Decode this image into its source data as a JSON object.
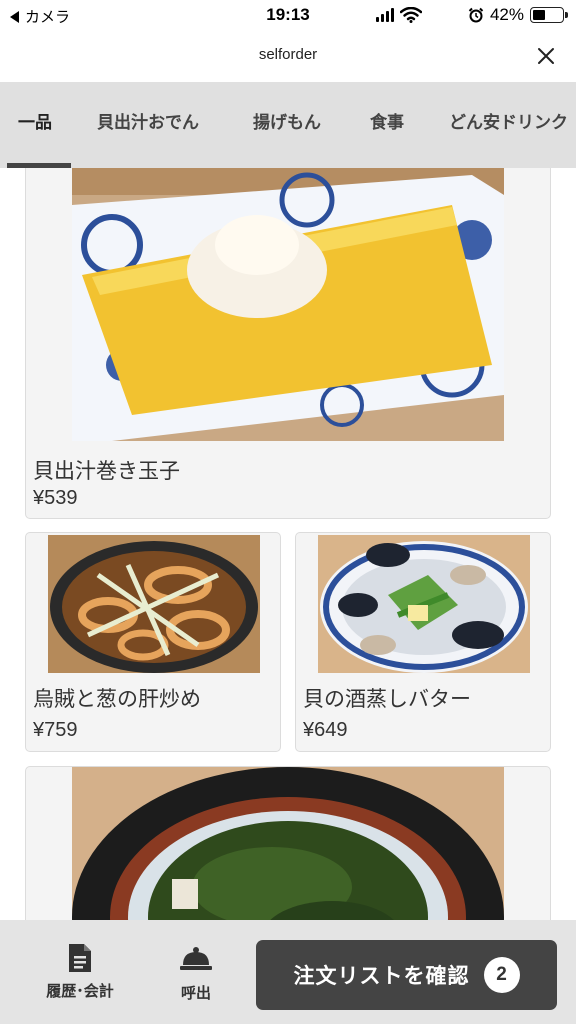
{
  "status_bar": {
    "back_label": "カメラ",
    "time": "19:13",
    "battery_percent": "42%",
    "battery_level": 0.42,
    "icons": [
      "back-arrow-icon",
      "signal-icon",
      "wifi-icon",
      "alarm-icon",
      "battery-icon"
    ]
  },
  "header": {
    "title": "selforder",
    "close_icon": "close-icon"
  },
  "tabs": [
    {
      "label": "一品",
      "active": true
    },
    {
      "label": "貝出汁おでん",
      "active": false
    },
    {
      "label": "揚げもん",
      "active": false
    },
    {
      "label": "食事",
      "active": false
    },
    {
      "label": "どん安ドリンク",
      "active": false
    }
  ],
  "menu_items": [
    {
      "name": "貝出汁巻き玉子",
      "price": "¥539",
      "image": "rolled-omelette-photo"
    },
    {
      "name": "烏賊と葱の肝炒め",
      "price": "¥759",
      "image": "squid-stirfry-photo"
    },
    {
      "name": "貝の酒蒸しバター",
      "price": "¥649",
      "image": "steamed-clams-photo"
    },
    {
      "name": "",
      "price": "",
      "image": "seaweed-hotpot-photo"
    }
  ],
  "bottom_bar": {
    "history_label": "履歴･会計",
    "call_label": "呼出",
    "confirm_label": "注文リストを確認",
    "cart_count": "2",
    "icons": [
      "document-icon",
      "bell-icon"
    ]
  },
  "colors": {
    "tab_bar_bg": "#e0e0e0",
    "bottom_bar_bg": "#e4e4e4",
    "confirm_button_bg": "#444444",
    "card_bg": "#f4f4f4"
  }
}
